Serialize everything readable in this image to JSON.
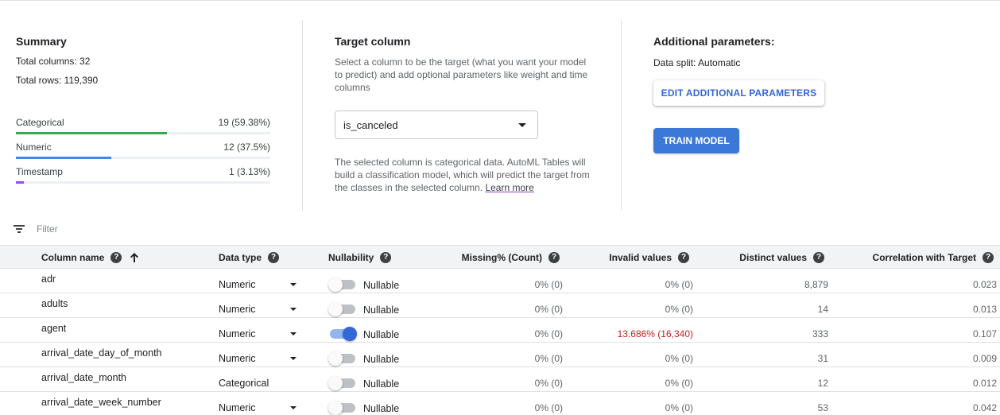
{
  "summary": {
    "title": "Summary",
    "total_columns": "Total columns: 32",
    "total_rows": "Total rows: 119,390",
    "stats": [
      {
        "label": "Categorical",
        "value": "19 (59.38%)",
        "fraction": 0.5938,
        "color": "#34a853"
      },
      {
        "label": "Numeric",
        "value": "12 (37.5%)",
        "fraction": 0.375,
        "color": "#4285f4"
      },
      {
        "label": "Timestamp",
        "value": "1 (3.13%)",
        "fraction": 0.0313,
        "color": "#a142f4"
      }
    ]
  },
  "target": {
    "title": "Target column",
    "description": "Select a column to be the target (what you want your model to predict) and add optional parameters like weight and time columns",
    "selected": "is_canceled",
    "note": "The selected column is categorical data. AutoML Tables will build a classification model, which will predict the target from the classes in the selected column.",
    "learn_more": "Learn more"
  },
  "additional": {
    "title": "Additional parameters:",
    "data_split": "Data split: Automatic",
    "edit_button": "EDIT ADDITIONAL PARAMETERS",
    "train_button": "TRAIN MODEL"
  },
  "filter": {
    "placeholder": "Filter"
  },
  "table": {
    "headers": {
      "name": "Column name",
      "type": "Data type",
      "nullability": "Nullability",
      "missing": "Missing% (Count)",
      "invalid": "Invalid values",
      "distinct": "Distinct values",
      "correlation": "Correlation with Target"
    },
    "rows": [
      {
        "name": "adr",
        "type": "Numeric",
        "nullable": "Nullable",
        "on": false,
        "missing": "0% (0)",
        "invalid": "0% (0)",
        "distinct": "8,879",
        "corr": "0.023"
      },
      {
        "name": "adults",
        "type": "Numeric",
        "nullable": "Nullable",
        "on": false,
        "missing": "0% (0)",
        "invalid": "0% (0)",
        "distinct": "14",
        "corr": "0.013"
      },
      {
        "name": "agent",
        "type": "Numeric",
        "nullable": "Nullable",
        "on": true,
        "missing": "0% (0)",
        "invalid": "13.686% (16,340)",
        "distinct": "333",
        "corr": "0.107"
      },
      {
        "name": "arrival_date_day_of_month",
        "type": "Numeric",
        "nullable": "Nullable",
        "on": false,
        "missing": "0% (0)",
        "invalid": "0% (0)",
        "distinct": "31",
        "corr": "0.009"
      },
      {
        "name": "arrival_date_month",
        "type": "Categorical",
        "nullable": "Nullable",
        "on": false,
        "missing": "0% (0)",
        "invalid": "0% (0)",
        "distinct": "12",
        "corr": "0.012"
      },
      {
        "name": "arrival_date_week_number",
        "type": "Numeric",
        "nullable": "Nullable",
        "on": false,
        "missing": "0% (0)",
        "invalid": "0% (0)",
        "distinct": "53",
        "corr": "0.042"
      }
    ]
  }
}
